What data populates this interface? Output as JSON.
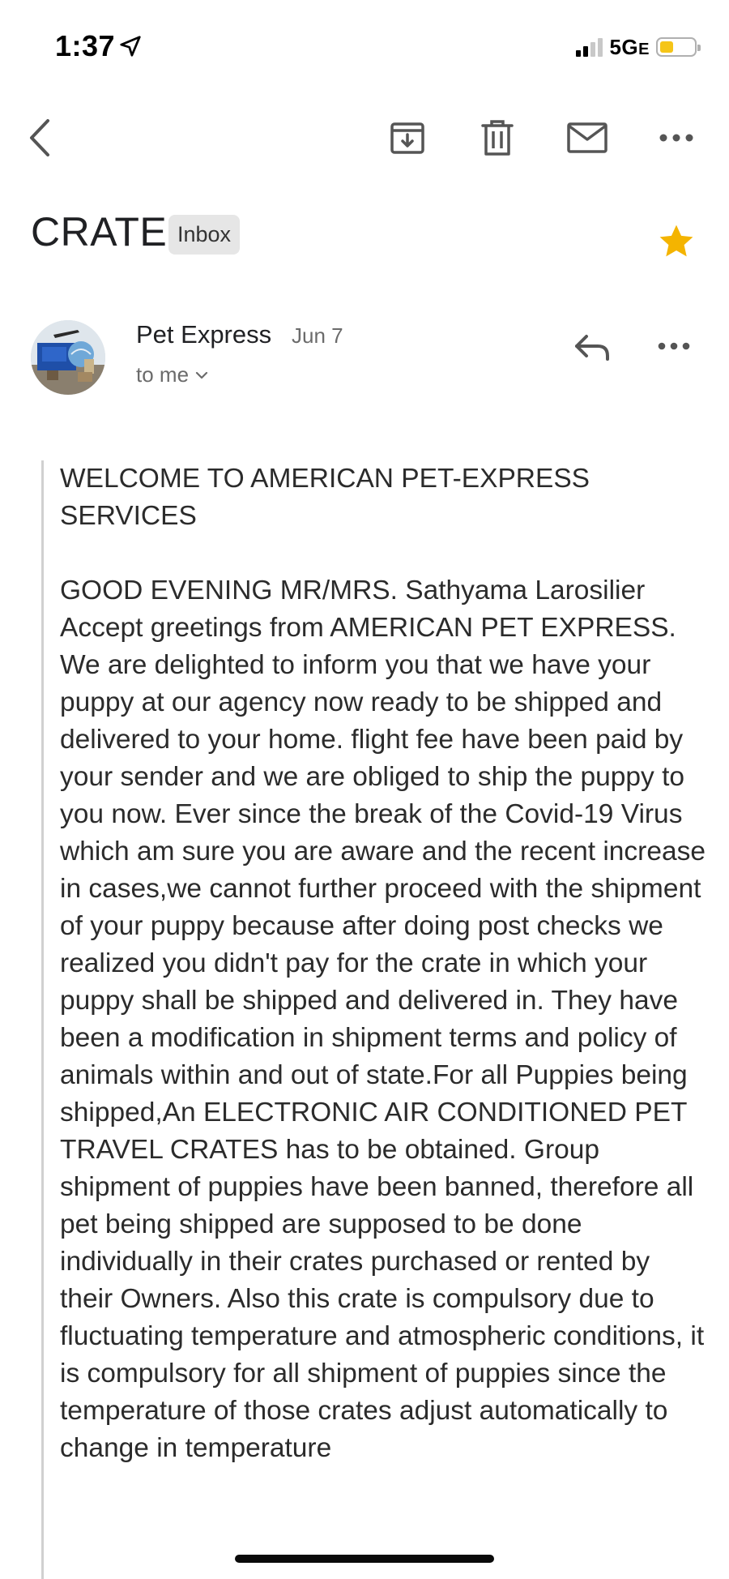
{
  "status_bar": {
    "time": "1:37",
    "network": "5G",
    "network_suffix": "E",
    "battery_color": "#f5c518"
  },
  "toolbar": {
    "icons": [
      "back-arrow-icon",
      "archive-icon",
      "trash-icon",
      "mail-icon",
      "more-icon"
    ]
  },
  "email": {
    "subject": "CRATE",
    "label": "Inbox",
    "starred": true,
    "star_color": "#f4b400",
    "sender": "Pet Express",
    "date": "Jun 7",
    "recipients": "to me",
    "body": {
      "heading": "WELCOME TO AMERICAN PET-EXPRESS SERVICES",
      "paragraph": "GOOD EVENING MR/MRS. Sathyama Larosilier\n Accept greetings from AMERICAN PET EXPRESS. We are delighted to inform you that we have your puppy at our agency now ready to be shipped and delivered to your home. flight fee have been paid by your sender and we are obliged to ship the puppy to you now. Ever since the break of the Covid-19 Virus which am sure you are aware and the recent increase in cases,we cannot further proceed with the shipment of your puppy because after doing post checks we realized you didn't pay for the crate in which your puppy shall be shipped and delivered in. They have been a modification in shipment terms and policy of animals within and out of state.For all Puppies being shipped,An ELECTRONIC AIR CONDITIONED PET TRAVEL CRATES has to be obtained. Group shipment of puppies have been banned, therefore all pet being shipped are supposed to be done individually in their crates purchased or rented by their Owners. Also this crate is compulsory due to fluctuating temperature and atmospheric conditions, it is compulsory for all shipment of puppies since the temperature of those crates adjust automatically to change in temperature"
    }
  }
}
